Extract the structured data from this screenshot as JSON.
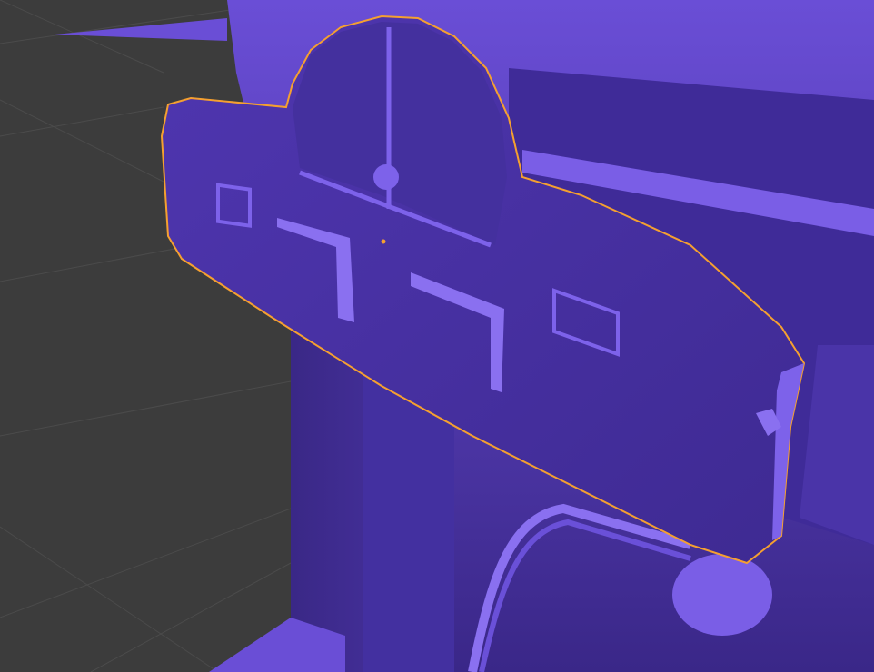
{
  "viewport": {
    "mode": "3d-viewport",
    "background_color": "#3c3c3c",
    "grid_color": "#4a4a4a",
    "model_color": "#6b4fd8",
    "selection_outline_color": "#f5a030",
    "selected_object": "panel-plate",
    "origin_marker_color": "#f5a030"
  }
}
